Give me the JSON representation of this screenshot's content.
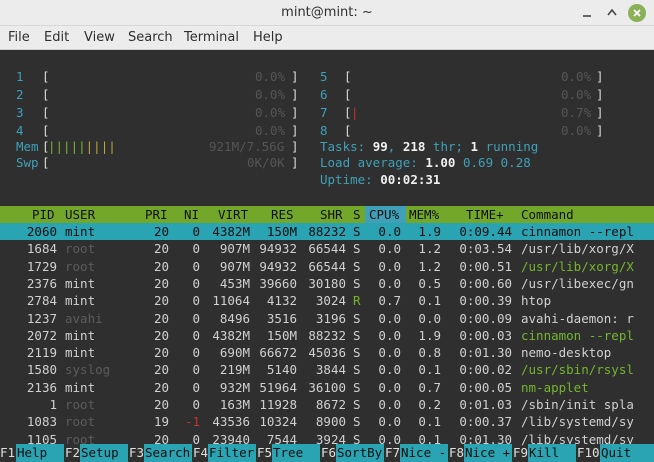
{
  "window": {
    "title": "mint@mint: ~"
  },
  "menu": [
    "File",
    "Edit",
    "View",
    "Search",
    "Terminal",
    "Help"
  ],
  "cpu_meters": [
    {
      "id": "1",
      "percent": "0.0%"
    },
    {
      "id": "2",
      "percent": "0.0%"
    },
    {
      "id": "3",
      "percent": "0.0%"
    },
    {
      "id": "4",
      "percent": "0.0%"
    },
    {
      "id": "5",
      "percent": "0.0%"
    },
    {
      "id": "6",
      "percent": "0.0%"
    },
    {
      "id": "7",
      "percent": "0.7%"
    },
    {
      "id": "8",
      "percent": "0.0%"
    }
  ],
  "mem": {
    "label": "Mem",
    "value": "921M/7.56G"
  },
  "swp": {
    "label": "Swp",
    "value": "0K/0K"
  },
  "tasks": {
    "label": "Tasks:",
    "count": "99",
    "sep": ", ",
    "threads": "218",
    "thr_label": " thr; ",
    "running": "1",
    "running_label": " running"
  },
  "load": {
    "label": "Load average: ",
    "v1": "1.00",
    "v5": "0.69",
    "v15": "0.28"
  },
  "uptime": {
    "label": "Uptime: ",
    "value": "00:02:31"
  },
  "columns": [
    "PID",
    "USER",
    "PRI",
    "NI",
    "VIRT",
    "RES",
    "SHR",
    "S",
    "CPU%",
    "MEM%",
    "TIME+",
    "Command"
  ],
  "processes": [
    {
      "pid": "2060",
      "user": "mint",
      "pri": "20",
      "ni": "0",
      "virt": "4382M",
      "res": "150M",
      "shr": "88232",
      "s": "S",
      "cpu": "0.0",
      "mem": "1.9",
      "time": "0:09.44",
      "cmd": "cinnamon --repl"
    },
    {
      "pid": "1684",
      "user": "root",
      "pri": "20",
      "ni": "0",
      "virt": "907M",
      "res": "94932",
      "shr": "66544",
      "s": "S",
      "cpu": "0.0",
      "mem": "1.2",
      "time": "0:03.54",
      "cmd": "/usr/lib/xorg/X"
    },
    {
      "pid": "1729",
      "user": "root",
      "pri": "20",
      "ni": "0",
      "virt": "907M",
      "res": "94932",
      "shr": "66544",
      "s": "S",
      "cpu": "0.0",
      "mem": "1.2",
      "time": "0:00.51",
      "cmd": "/usr/lib/xorg/X"
    },
    {
      "pid": "2376",
      "user": "mint",
      "pri": "20",
      "ni": "0",
      "virt": "453M",
      "res": "39660",
      "shr": "30180",
      "s": "S",
      "cpu": "0.0",
      "mem": "0.5",
      "time": "0:00.60",
      "cmd": "/usr/libexec/gn"
    },
    {
      "pid": "2784",
      "user": "mint",
      "pri": "20",
      "ni": "0",
      "virt": "11064",
      "res": "4132",
      "shr": "3024",
      "s": "R",
      "cpu": "0.7",
      "mem": "0.1",
      "time": "0:00.39",
      "cmd": "htop"
    },
    {
      "pid": "1237",
      "user": "avahi",
      "pri": "20",
      "ni": "0",
      "virt": "8496",
      "res": "3516",
      "shr": "3196",
      "s": "S",
      "cpu": "0.0",
      "mem": "0.0",
      "time": "0:00.09",
      "cmd": "avahi-daemon: r"
    },
    {
      "pid": "2072",
      "user": "mint",
      "pri": "20",
      "ni": "0",
      "virt": "4382M",
      "res": "150M",
      "shr": "88232",
      "s": "S",
      "cpu": "0.0",
      "mem": "1.9",
      "time": "0:00.03",
      "cmd": "cinnamon --repl"
    },
    {
      "pid": "2119",
      "user": "mint",
      "pri": "20",
      "ni": "0",
      "virt": "690M",
      "res": "66672",
      "shr": "45036",
      "s": "S",
      "cpu": "0.0",
      "mem": "0.8",
      "time": "0:01.30",
      "cmd": "nemo-desktop"
    },
    {
      "pid": "1580",
      "user": "syslog",
      "pri": "20",
      "ni": "0",
      "virt": "219M",
      "res": "5140",
      "shr": "3844",
      "s": "S",
      "cpu": "0.0",
      "mem": "0.1",
      "time": "0:00.02",
      "cmd": "/usr/sbin/rsysl"
    },
    {
      "pid": "2136",
      "user": "mint",
      "pri": "20",
      "ni": "0",
      "virt": "932M",
      "res": "51964",
      "shr": "36100",
      "s": "S",
      "cpu": "0.0",
      "mem": "0.7",
      "time": "0:00.05",
      "cmd": "nm-applet"
    },
    {
      "pid": "1",
      "user": "root",
      "pri": "20",
      "ni": "0",
      "virt": "163M",
      "res": "11928",
      "shr": "8672",
      "s": "S",
      "cpu": "0.0",
      "mem": "0.2",
      "time": "0:01.03",
      "cmd": "/sbin/init spla"
    },
    {
      "pid": "1083",
      "user": "root",
      "pri": "19",
      "ni": "-1",
      "virt": "43536",
      "res": "10324",
      "shr": "8900",
      "s": "S",
      "cpu": "0.0",
      "mem": "0.1",
      "time": "0:00.37",
      "cmd": "/lib/systemd/sy"
    },
    {
      "pid": "1105",
      "user": "root",
      "pri": "20",
      "ni": "0",
      "virt": "23940",
      "res": "7544",
      "shr": "3924",
      "s": "S",
      "cpu": "0.0",
      "mem": "0.1",
      "time": "0:01.30",
      "cmd": "/lib/systemd/sy"
    }
  ],
  "function_keys": [
    {
      "key": "F1",
      "label": "Help"
    },
    {
      "key": "F2",
      "label": "Setup"
    },
    {
      "key": "F3",
      "label": "Search"
    },
    {
      "key": "F4",
      "label": "Filter"
    },
    {
      "key": "F5",
      "label": "Tree"
    },
    {
      "key": "F6",
      "label": "SortBy"
    },
    {
      "key": "F7",
      "label": "Nice -"
    },
    {
      "key": "F8",
      "label": "Nice +"
    },
    {
      "key": "F9",
      "label": "Kill"
    },
    {
      "key": "F10",
      "label": "Quit"
    }
  ],
  "colors": {
    "header_bg": "#73a72a",
    "selected_bg": "#2aa3b3",
    "terminal_bg": "#2f2f2f",
    "close_button": "#8bb158"
  }
}
